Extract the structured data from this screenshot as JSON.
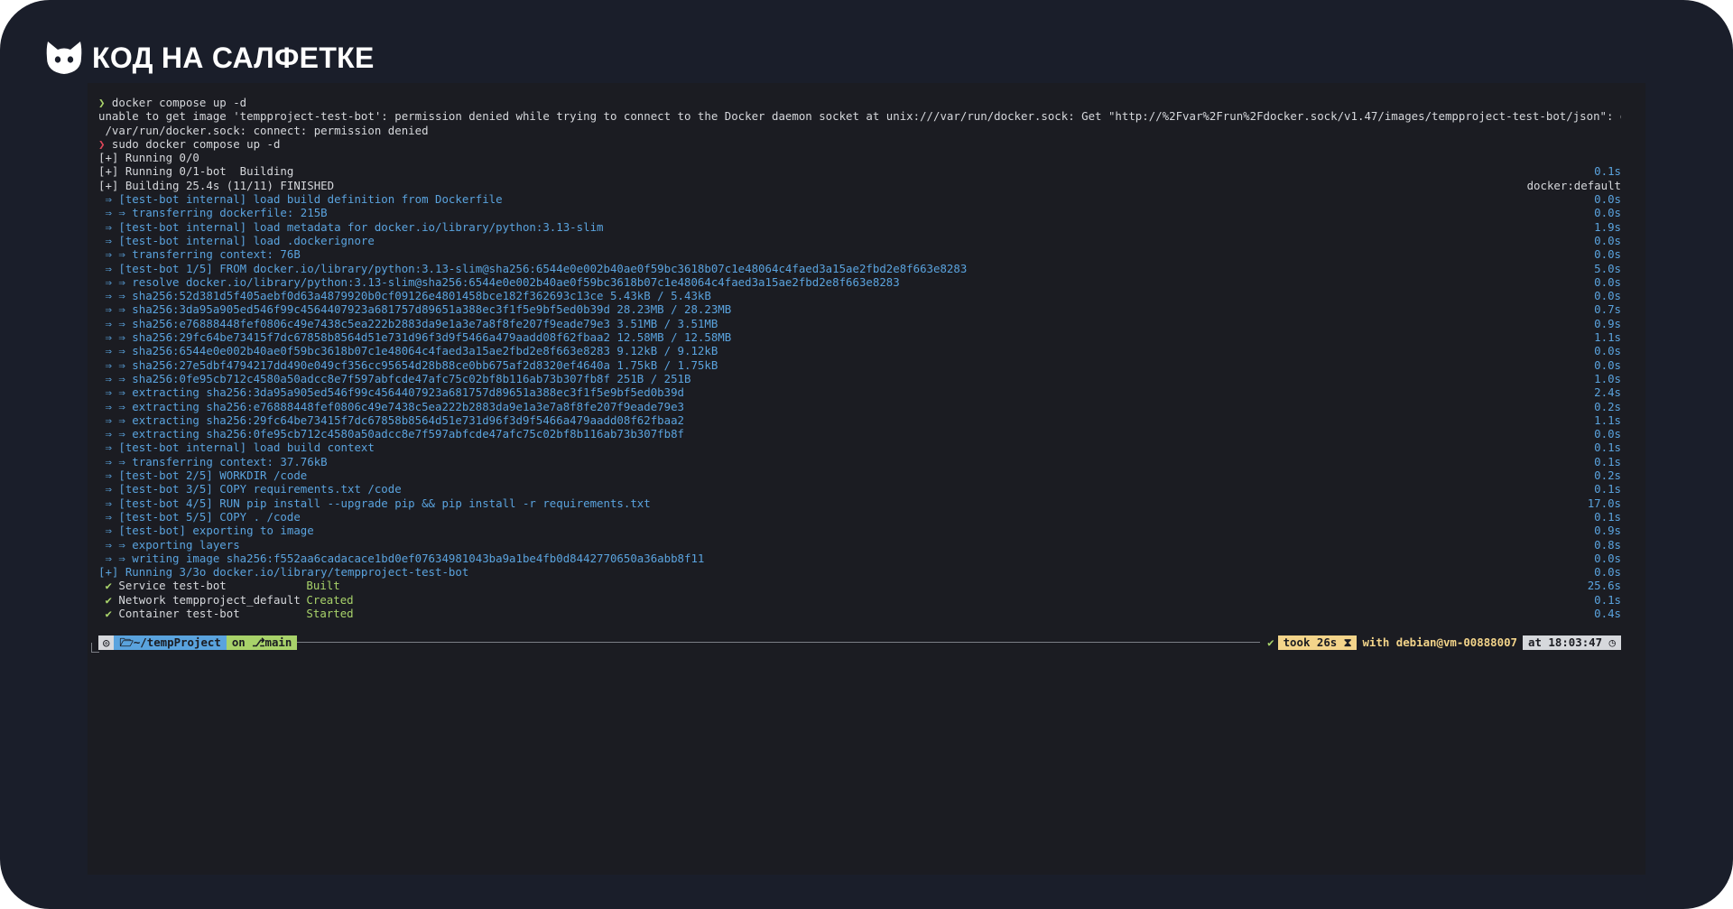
{
  "brand": {
    "name": "КОД НА САЛФЕТКЕ",
    "logo_icon": "cat-logo-icon"
  },
  "terminal": {
    "lines": [
      {
        "text": "❯ docker compose up -d",
        "time": "",
        "color": "prompt"
      },
      {
        "text": "unable to get image 'tempproject-test-bot': permission denied while trying to connect to the Docker daemon socket at unix:///var/run/docker.sock: Get \"http://%2Fvar%2Frun%2Fdocker.sock/v1.47/images/tempproject-test-bot/json\": dial unix",
        "time": "",
        "color": "white"
      },
      {
        "text": " /var/run/docker.sock: connect: permission denied",
        "time": "",
        "color": "white"
      },
      {
        "text": "❯ sudo docker compose up -d",
        "time": "",
        "color": "prompt-red"
      },
      {
        "text": "[+] Running 0/0",
        "time": "",
        "color": "white"
      },
      {
        "text": "[+] Running 0/1-bot  Building",
        "time": "0.1s",
        "color": "white"
      },
      {
        "text": "[+] Building 25.4s (11/11) FINISHED",
        "time": "docker:default",
        "color": "white",
        "time_color": "white"
      },
      {
        "text": " ⇒ [test-bot internal] load build definition from Dockerfile",
        "time": "0.0s",
        "color": "blue"
      },
      {
        "text": " ⇒ ⇒ transferring dockerfile: 215B",
        "time": "0.0s",
        "color": "blue"
      },
      {
        "text": " ⇒ [test-bot internal] load metadata for docker.io/library/python:3.13-slim",
        "time": "1.9s",
        "color": "blue"
      },
      {
        "text": " ⇒ [test-bot internal] load .dockerignore",
        "time": "0.0s",
        "color": "blue"
      },
      {
        "text": " ⇒ ⇒ transferring context: 76B",
        "time": "0.0s",
        "color": "blue"
      },
      {
        "text": " ⇒ [test-bot 1/5] FROM docker.io/library/python:3.13-slim@sha256:6544e0e002b40ae0f59bc3618b07c1e48064c4faed3a15ae2fbd2e8f663e8283",
        "time": "5.0s",
        "color": "blue"
      },
      {
        "text": " ⇒ ⇒ resolve docker.io/library/python:3.13-slim@sha256:6544e0e002b40ae0f59bc3618b07c1e48064c4faed3a15ae2fbd2e8f663e8283",
        "time": "0.0s",
        "color": "blue"
      },
      {
        "text": " ⇒ ⇒ sha256:52d381d5f405aebf0d63a4879920b0cf09126e4801458bce182f362693c13ce 5.43kB / 5.43kB",
        "time": "0.0s",
        "color": "blue"
      },
      {
        "text": " ⇒ ⇒ sha256:3da95a905ed546f99c4564407923a681757d89651a388ec3f1f5e9bf5ed0b39d 28.23MB / 28.23MB",
        "time": "0.7s",
        "color": "blue"
      },
      {
        "text": " ⇒ ⇒ sha256:e76888448fef0806c49e7438c5ea222b2883da9e1a3e7a8f8fe207f9eade79e3 3.51MB / 3.51MB",
        "time": "0.9s",
        "color": "blue"
      },
      {
        "text": " ⇒ ⇒ sha256:29fc64be73415f7dc67858b8564d51e731d96f3d9f5466a479aadd08f62fbaa2 12.58MB / 12.58MB",
        "time": "1.1s",
        "color": "blue"
      },
      {
        "text": " ⇒ ⇒ sha256:6544e0e002b40ae0f59bc3618b07c1e48064c4faed3a15ae2fbd2e8f663e8283 9.12kB / 9.12kB",
        "time": "0.0s",
        "color": "blue"
      },
      {
        "text": " ⇒ ⇒ sha256:27e5dbf4794217dd490e049cf356cc95654d28b88ce0bb675af2d8320ef4640a 1.75kB / 1.75kB",
        "time": "0.0s",
        "color": "blue"
      },
      {
        "text": " ⇒ ⇒ sha256:0fe95cb712c4580a50adcc8e7f597abfcde47afc75c02bf8b116ab73b307fb8f 251B / 251B",
        "time": "1.0s",
        "color": "blue"
      },
      {
        "text": " ⇒ ⇒ extracting sha256:3da95a905ed546f99c4564407923a681757d89651a388ec3f1f5e9bf5ed0b39d",
        "time": "2.4s",
        "color": "blue"
      },
      {
        "text": " ⇒ ⇒ extracting sha256:e76888448fef0806c49e7438c5ea222b2883da9e1a3e7a8f8fe207f9eade79e3",
        "time": "0.2s",
        "color": "blue"
      },
      {
        "text": " ⇒ ⇒ extracting sha256:29fc64be73415f7dc67858b8564d51e731d96f3d9f5466a479aadd08f62fbaa2",
        "time": "1.1s",
        "color": "blue"
      },
      {
        "text": " ⇒ ⇒ extracting sha256:0fe95cb712c4580a50adcc8e7f597abfcde47afc75c02bf8b116ab73b307fb8f",
        "time": "0.0s",
        "color": "blue"
      },
      {
        "text": " ⇒ [test-bot internal] load build context",
        "time": "0.1s",
        "color": "blue"
      },
      {
        "text": " ⇒ ⇒ transferring context: 37.76kB",
        "time": "0.1s",
        "color": "blue"
      },
      {
        "text": " ⇒ [test-bot 2/5] WORKDIR /code",
        "time": "0.2s",
        "color": "blue"
      },
      {
        "text": " ⇒ [test-bot 3/5] COPY requirements.txt /code",
        "time": "0.1s",
        "color": "blue"
      },
      {
        "text": " ⇒ [test-bot 4/5] RUN pip install --upgrade pip && pip install -r requirements.txt",
        "time": "17.0s",
        "color": "blue"
      },
      {
        "text": " ⇒ [test-bot 5/5] COPY . /code",
        "time": "0.1s",
        "color": "blue"
      },
      {
        "text": " ⇒ [test-bot] exporting to image",
        "time": "0.9s",
        "color": "blue"
      },
      {
        "text": " ⇒ ⇒ exporting layers",
        "time": "0.8s",
        "color": "blue"
      },
      {
        "text": " ⇒ ⇒ writing image sha256:f552aa6cadacace1bd0ef07634981043ba9a1be4fb0d8442770650a36abb8f11",
        "time": "0.0s",
        "color": "blue"
      },
      {
        "text": "[+] Running 3/3o docker.io/library/tempproject-test-bot",
        "time": "0.0s",
        "color": "blue"
      }
    ],
    "services": [
      {
        "check": "✔",
        "name": "Service test-bot",
        "status": "Built",
        "time": "25.6s"
      },
      {
        "check": "✔",
        "name": "Network tempproject_default",
        "status": "Created",
        "time": "0.1s"
      },
      {
        "check": "✔",
        "name": "Container test-bot",
        "status": "Started",
        "time": "0.4s"
      }
    ],
    "prompt": {
      "os_icon": "◎",
      "dir": "~/tempProject",
      "git_on": "on",
      "git_branch": "main",
      "status_ok": "✔",
      "took": "took 26s ⧗",
      "with": "with debian@vm-00888007",
      "at": "at 18:03:47 ◷"
    }
  },
  "colors": {
    "background": "#1a1e2a",
    "terminal_bg": "#1b1c22",
    "text_white": "#d6d8dc",
    "text_blue": "#5aa3de",
    "text_green": "#a8d26a",
    "text_red": "#e0475a",
    "accent_yellow": "#f3d48a"
  }
}
